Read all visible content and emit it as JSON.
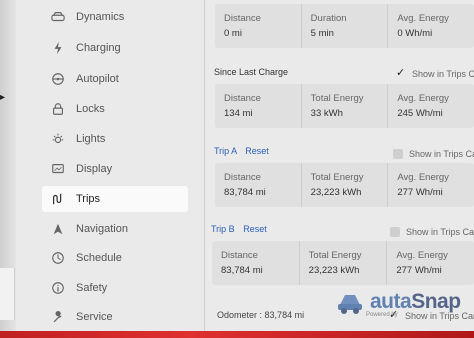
{
  "sidebar": {
    "items": [
      {
        "label": "Dynamics",
        "icon": "car-icon"
      },
      {
        "label": "Charging",
        "icon": "lightning-icon"
      },
      {
        "label": "Autopilot",
        "icon": "steering-wheel-icon"
      },
      {
        "label": "Locks",
        "icon": "lock-icon"
      },
      {
        "label": "Lights",
        "icon": "light-icon"
      },
      {
        "label": "Display",
        "icon": "display-icon"
      },
      {
        "label": "Trips",
        "icon": "trips-icon",
        "active": true
      },
      {
        "label": "Navigation",
        "icon": "navigation-arrow-icon"
      },
      {
        "label": "Schedule",
        "icon": "clock-icon"
      },
      {
        "label": "Safety",
        "icon": "info-icon"
      },
      {
        "label": "Service",
        "icon": "wrench-icon"
      }
    ]
  },
  "current_drive": {
    "stats": [
      {
        "label": "Distance",
        "value": "0 mi"
      },
      {
        "label": "Duration",
        "value": "5 min"
      },
      {
        "label": "Avg. Energy",
        "value": "0 Wh/mi"
      }
    ]
  },
  "since_last_charge": {
    "title": "Since Last Charge",
    "show_in_trips": "Show in Trips C",
    "show_in_trips_checked": true,
    "stats": [
      {
        "label": "Distance",
        "value": "134 mi"
      },
      {
        "label": "Total Energy",
        "value": "33 kWh"
      },
      {
        "label": "Avg. Energy",
        "value": "245 Wh/mi"
      }
    ]
  },
  "trip_a": {
    "title": "Trip A",
    "reset": "Reset",
    "show_in_trips": "Show in Trips Ca",
    "show_in_trips_checked": false,
    "stats": [
      {
        "label": "Distance",
        "value": "83,784 mi"
      },
      {
        "label": "Total Energy",
        "value": "23,223 kWh"
      },
      {
        "label": "Avg. Energy",
        "value": "277 Wh/mi"
      }
    ]
  },
  "trip_b": {
    "title": "Trip B",
    "reset": "Reset",
    "show_in_trips": "Show in Trips Car",
    "show_in_trips_checked": false,
    "stats": [
      {
        "label": "Distance",
        "value": "83,784 mi"
      },
      {
        "label": "Total Energy",
        "value": "23,223 kWh"
      },
      {
        "label": "Avg. Energy",
        "value": "277 Wh/mi"
      }
    ]
  },
  "odometer": {
    "label": "Odometer",
    "value": "83,784 mi",
    "show_in_trips": "Show in Trips Car",
    "show_in_trips_checked": true
  },
  "watermark": {
    "brand_a": "auta",
    "brand_b": "Snap",
    "sub": "Powered by"
  },
  "colors": {
    "link": "#2b5fb5",
    "card": "#e0e0e0",
    "bg": "#eaeaea"
  }
}
